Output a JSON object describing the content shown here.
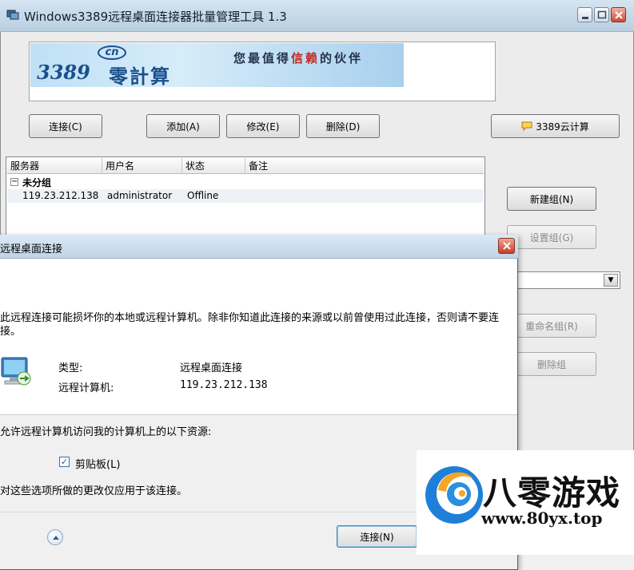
{
  "window": {
    "title": "Windows3389远程桌面连接器批量管理工具 1.3"
  },
  "banner": {
    "logo_number": "3389",
    "logo_badge": "cn",
    "logo_brand": "零計算",
    "slogan_before": "您最值得",
    "slogan_em": "信赖",
    "slogan_after": "的伙伴"
  },
  "toolbar": {
    "connect": "连接(C)",
    "add": "添加(A)",
    "edit": "修改(E)",
    "delete": "删除(D)",
    "cloud": "3389云计算"
  },
  "list": {
    "columns": [
      "服务器",
      "用户名",
      "状态",
      "备注"
    ],
    "group": "未分组",
    "rows": [
      {
        "server": "119.23.212.138",
        "user": "administrator",
        "status": "Offline",
        "note": ""
      }
    ]
  },
  "groups": {
    "new": "新建组(N)",
    "settings": "设置组(G)",
    "rename": "重命名组(R)",
    "delete": "删除组"
  },
  "dialog": {
    "title": "远程桌面连接",
    "warning": "此远程连接可能损坏你的本地或远程计算机。除非你知道此连接的来源或以前曾使用过此连接，否则请不要连接。",
    "type_label": "类型:",
    "type_value": "远程桌面连接",
    "computer_label": "远程计算机:",
    "computer_value": "119.23.212.138",
    "resources_label": "允许远程计算机访问我的计算机上的以下资源:",
    "clipboard": "剪贴板(L)",
    "note": "对这些选项所做的更改仅应用于该连接。",
    "connect": "连接(N)"
  },
  "watermark": {
    "name": "八零游戏",
    "url": "www.80yx.top"
  },
  "colors": {
    "accent": "#1b4f8c",
    "close_red": "#c94a35",
    "slogan_em": "#c0281e"
  }
}
